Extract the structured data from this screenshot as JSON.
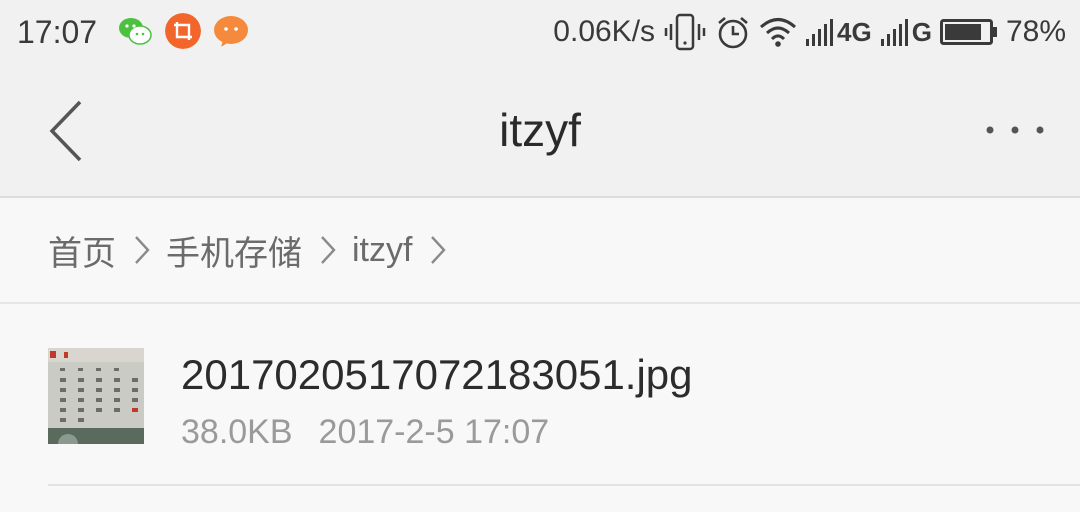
{
  "status_bar": {
    "time": "17:07",
    "net_speed": "0.06K/s",
    "signal1_label": "4G",
    "signal2_label": "G",
    "battery": "78%",
    "notification_icons": [
      "wechat-icon",
      "screenshot-crop-icon",
      "chat-bubble-icon"
    ],
    "status_icons": [
      "vibrate-icon",
      "alarm-icon",
      "wifi-icon",
      "signal-icon",
      "signal-icon",
      "battery-icon"
    ],
    "colors": {
      "wechat": "#4cc13f",
      "crop": "#f2652b",
      "chat": "#f58a3d"
    }
  },
  "title_bar": {
    "title": "itzyf",
    "back_icon": "chevron-left-icon",
    "more_icon": "more-dots-icon"
  },
  "breadcrumb": {
    "items": [
      "首页",
      "手机存储",
      "itzyf"
    ],
    "separator_icon": "chevron-right-icon"
  },
  "files": [
    {
      "name": "20170205170721830​51.jpg",
      "size": "38.0KB",
      "date": "2017-2-5 17:07",
      "thumbnail_icon": "calendar-photo-thumbnail"
    }
  ]
}
